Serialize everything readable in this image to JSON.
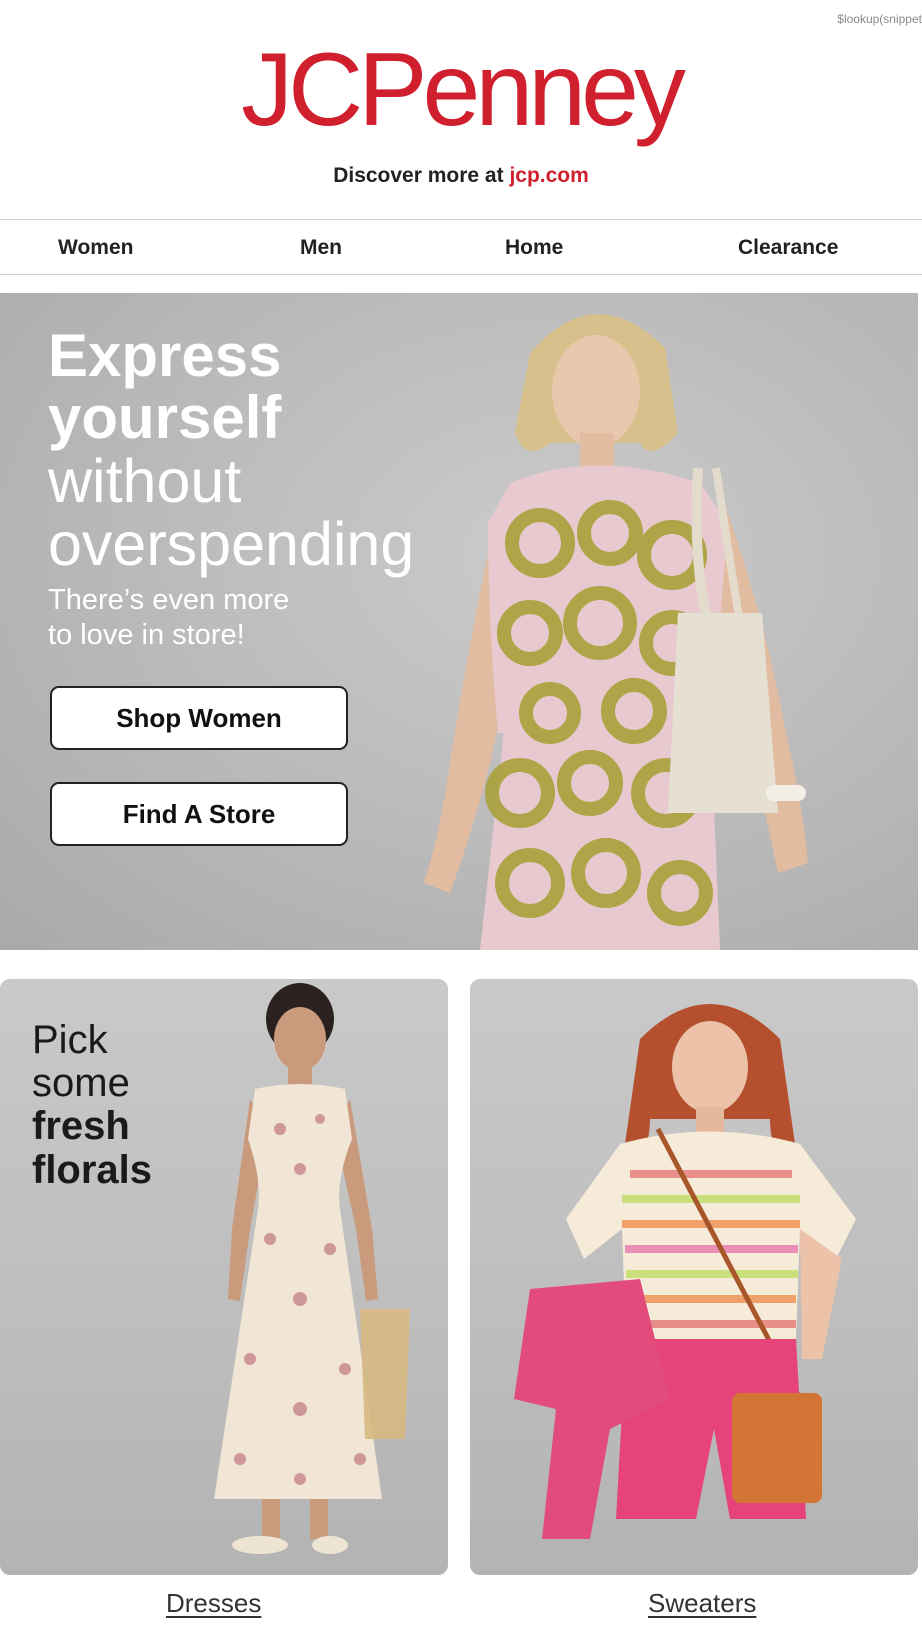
{
  "preheader": "$lookup(snippet",
  "brand": {
    "logo_text": "JCPenney",
    "discover_prefix": "Discover more at ",
    "discover_link": "jcp.com",
    "brand_color": "#d0202e"
  },
  "nav": {
    "items": [
      "Women",
      "Men",
      "Home",
      "Clearance"
    ]
  },
  "hero": {
    "headline_bold_1": "Express",
    "headline_bold_2": "yourself",
    "headline_light_1": "without",
    "headline_light_2": "overspending",
    "subline_1": "There’s even more",
    "subline_2": "to love in store!",
    "button_primary": "Shop Women",
    "button_secondary": "Find A Store"
  },
  "tiles": {
    "left": {
      "text_light_1": "Pick",
      "text_light_2": "some",
      "text_bold_1": "fresh",
      "text_bold_2": "florals",
      "link": "Dresses"
    },
    "right": {
      "link": "Sweaters"
    }
  }
}
